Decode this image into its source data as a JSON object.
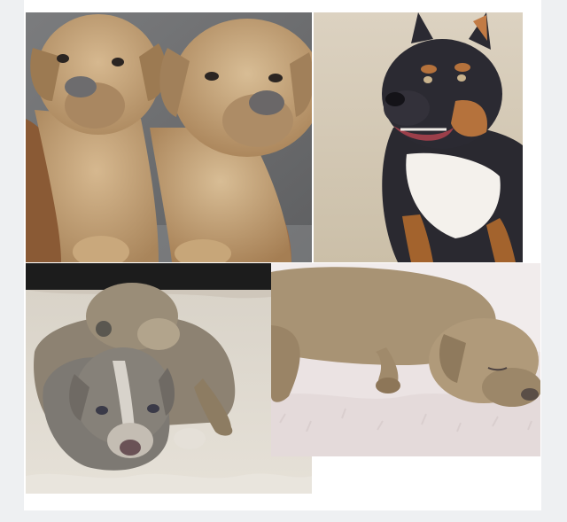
{
  "collage": {
    "background_color": "#eef0f2",
    "card_color": "#ffffff",
    "photos": [
      {
        "subject": "two-tan-puppies-held-up",
        "palette": [
          "#6e6f71",
          "#c6a57c",
          "#9a7048"
        ]
      },
      {
        "subject": "tricolor-bully-dog-sitting",
        "palette": [
          "#d8cdbb",
          "#2b2a32",
          "#b5723c",
          "#f4f1ec"
        ]
      },
      {
        "subject": "two-blue-puppies-on-rug",
        "palette": [
          "#e3ddd3",
          "#8a7f6e",
          "#7c7670"
        ]
      },
      {
        "subject": "puppy-sleeping-on-white-fur",
        "palette": [
          "#f1ecec",
          "#a58f70"
        ]
      }
    ]
  }
}
